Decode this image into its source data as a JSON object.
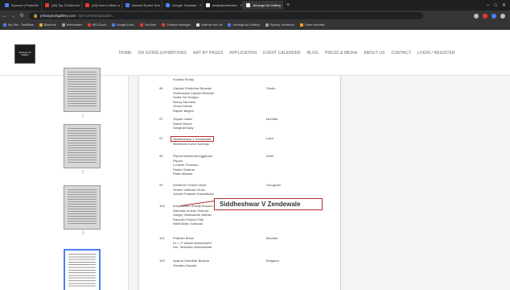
{
  "browser": {
    "tabs": [
      {
        "title": "Sponsor | PhotoDe",
        "color": "#4a7ff0",
        "active": false
      },
      {
        "title": "(28) Top 10 Best An",
        "color": "#e53935",
        "active": false
      },
      {
        "title": "(28) How to Make a",
        "color": "#e53935",
        "active": false
      },
      {
        "title": "Internet Speed Test",
        "color": "#4a7ff0",
        "active": false
      },
      {
        "title": "Google Translate",
        "color": "#4a7ff0",
        "active": false
      },
      {
        "title": "bestartprintmakin",
        "color": "#ffffff",
        "active": false
      },
      {
        "title": "Jehangir Art Gallery",
        "color": "#ffffff",
        "active": true
      }
    ],
    "url": {
      "domain": "jehangirartgallery.com",
      "path": "/wp-content/uploads/..."
    },
    "bookmarks": [
      {
        "label": "My Site - ThiefBlak",
        "color": "#4a7ff0"
      },
      {
        "label": "Bluehost",
        "color": "#f9a825"
      },
      {
        "label": "Webmaster",
        "color": "#9e9e9e"
      },
      {
        "label": "MS Cloud",
        "color": "#e53935"
      },
      {
        "label": "Google Docs",
        "color": "#4a7ff0"
      },
      {
        "label": "YouTube",
        "color": "#e53935"
      },
      {
        "label": "Finance manager",
        "color": "#e53935"
      },
      {
        "label": "Start art writ. kit",
        "color": "#e0e0e0"
      },
      {
        "label": "Jehangir Art Gallery",
        "color": "#4a7ff0"
      },
      {
        "label": "Sydney Jamieson",
        "color": "#9e9e9e"
      },
      {
        "label": "Other favorites",
        "color": "#f9a825"
      }
    ]
  },
  "site": {
    "logo_text": "Jehangir Art Gallery",
    "nav": [
      "HOME",
      "ON GOING EXHIBITIONS",
      "ART BY PAGES",
      "APPLICATION",
      "EVENT CALENDER",
      "BLOG",
      "PRESS & MEDIA",
      "ABOUT US",
      "CONTACT",
      "LOGIN / REGISTER"
    ]
  },
  "document": {
    "thumbnail_numbers": [
      "1",
      "2",
      "3",
      "4"
    ],
    "entries": [
      {
        "num": "",
        "names": [
          "Kavitha Reddy"
        ],
        "loc": ""
      },
      {
        "num": "96",
        "names": [
          "Captain Shriddhar Bhosale",
          "Shrinivasan Captain Bhosale",
          "Smita Giri Dongre",
          "Manoj Darvekar",
          "Vinod Kothari",
          "Rajesh Bagchi"
        ],
        "loc": "Studio"
      },
      {
        "num": "97",
        "names": [
          "Shyam Jadav",
          "Daniel Moore",
          "Sanghani Ajay"
        ],
        "loc": "Mumbai"
      },
      {
        "num": "97",
        "names": [
          "Siddheshwar V Zendewale",
          "Mahendra Kurve Neeraja"
        ],
        "loc": "Latur",
        "highlight": 0
      },
      {
        "num": "98",
        "names": [
          "Piyush Mahendra Aggarwal",
          "Piyush",
          "Lumesh Chauhan",
          "Pallavi Sharma",
          "Ritam Biswas"
        ],
        "loc": "Delhi"
      },
      {
        "num": "99",
        "names": [
          "Amrishan Vinesh Dinas",
          "Vinesh Vaibhavi Dinas",
          "Goheel Prakash Sawanthani"
        ],
        "loc": "Gurugram"
      },
      {
        "num": "100",
        "names": [
          "Anupraveen Shivaji Sharma",
          "Namrata Umesh Sharma",
          "Sanjay Vishwanath Jadhav",
          "Ramesh Prabhu Patil",
          "Nikhil Babu Gaikwad"
        ],
        "loc": "Mumbai"
      },
      {
        "num": "101",
        "names": [
          "Prakash Bhise",
          "Dr. L S Vasant Ashtamurthi",
          "Drs. Shantanu Maheshwari"
        ],
        "loc": "Mumbai"
      },
      {
        "num": "102",
        "names": [
          "Aparna Sreedhar Bedwar",
          "Shrutika Sawant"
        ],
        "loc": "Belgaum"
      }
    ],
    "callout_text": "Siddheshwar V Zendewale"
  }
}
